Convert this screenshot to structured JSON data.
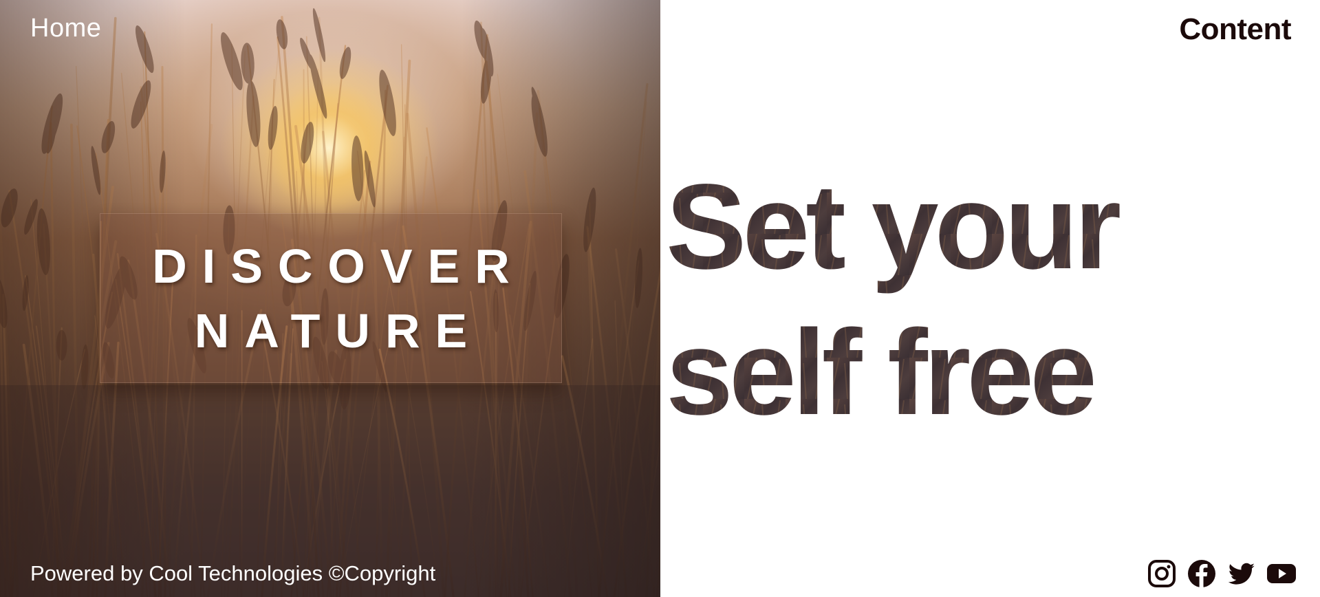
{
  "nav": {
    "home_label": "Home",
    "content_label": "Content"
  },
  "hero": {
    "title_line1": "DISCOVER",
    "title_line2": "NATURE"
  },
  "headline": {
    "line1": "Set your",
    "line2": "self free"
  },
  "footer": {
    "copyright": "Powered by Cool Technologies ©Copyright"
  },
  "social": [
    {
      "icon": "instagram-icon"
    },
    {
      "icon": "facebook-icon"
    },
    {
      "icon": "twitter-icon"
    },
    {
      "icon": "youtube-icon"
    }
  ],
  "colors": {
    "text_dark": "#1b0a0a",
    "headline_fill": "#4a3838",
    "hero_text": "#ffffff"
  }
}
